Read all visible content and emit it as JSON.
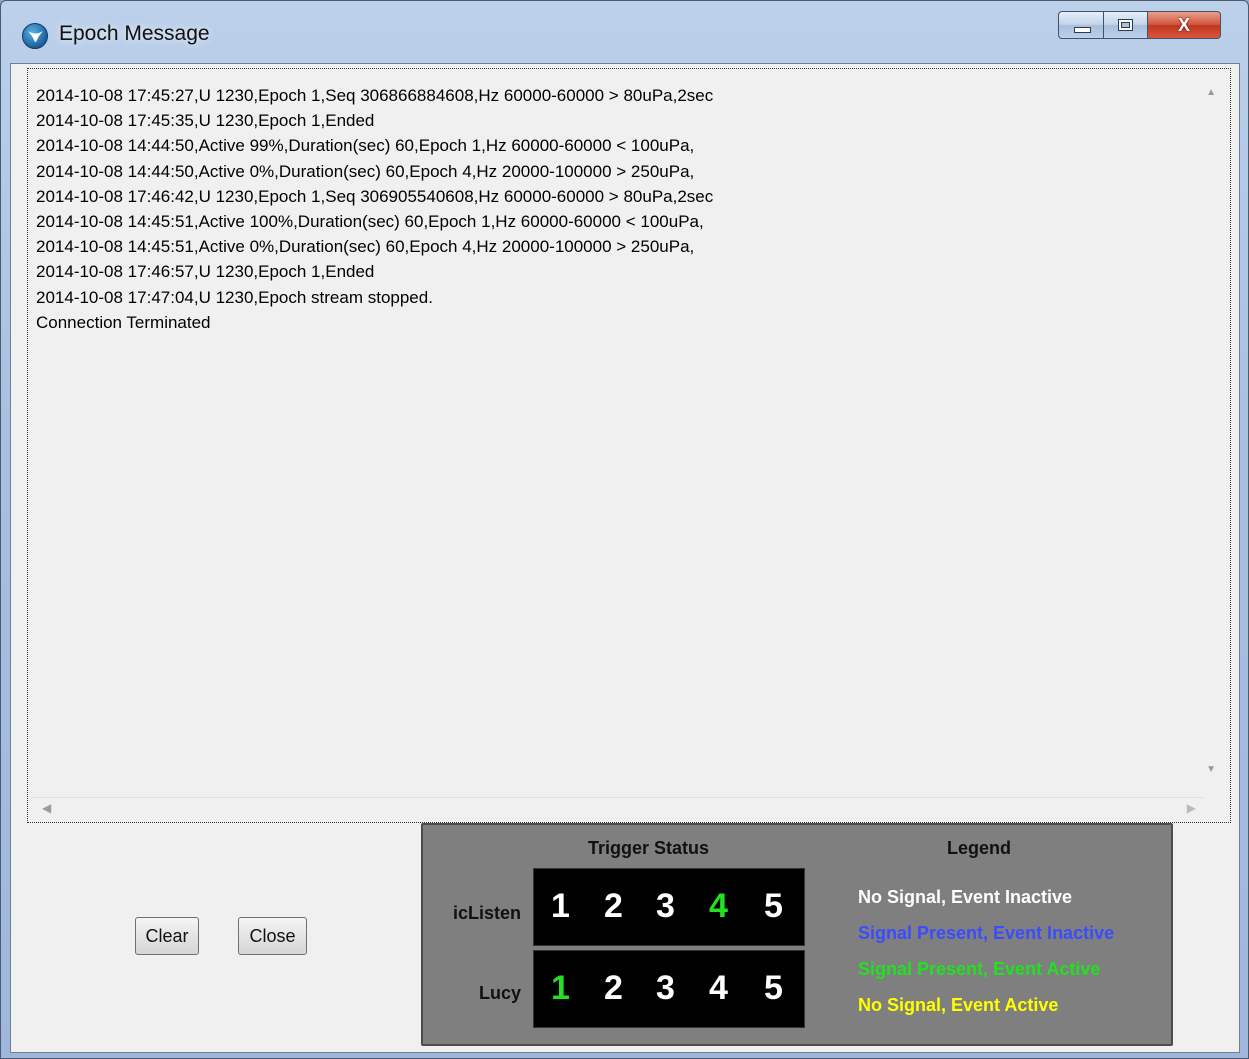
{
  "window": {
    "title": "Epoch Message",
    "close_label": "X"
  },
  "messages": [
    "2014-10-08 17:45:27,U 1230,Epoch 1,Seq 306866884608,Hz 60000-60000 > 80uPa,2sec",
    "2014-10-08 17:45:35,U 1230,Epoch 1,Ended",
    "2014-10-08 14:44:50,Active 99%,Duration(sec) 60,Epoch 1,Hz 60000-60000 < 100uPa,",
    "2014-10-08 14:44:50,Active 0%,Duration(sec) 60,Epoch 4,Hz 20000-100000 > 250uPa,",
    "2014-10-08 17:46:42,U 1230,Epoch 1,Seq 306905540608,Hz 60000-60000 > 80uPa,2sec",
    "2014-10-08 14:45:51,Active 100%,Duration(sec) 60,Epoch 1,Hz 60000-60000 < 100uPa,",
    "2014-10-08 14:45:51,Active 0%,Duration(sec) 60,Epoch 4,Hz 20000-100000 > 250uPa,",
    "2014-10-08 17:46:57,U 1230,Epoch 1,Ended",
    "2014-10-08 17:47:04,U 1230,Epoch stream stopped.",
    "Connection Terminated"
  ],
  "buttons": {
    "clear": "Clear",
    "close": "Close"
  },
  "trigger_status": {
    "heading": "Trigger Status",
    "rows": [
      {
        "label": "icListen",
        "digits": [
          {
            "text": "1",
            "state": "no-signal-inactive"
          },
          {
            "text": "2",
            "state": "no-signal-inactive"
          },
          {
            "text": "3",
            "state": "no-signal-inactive"
          },
          {
            "text": "4",
            "state": "signal-active"
          },
          {
            "text": "5",
            "state": "no-signal-inactive"
          }
        ]
      },
      {
        "label": "Lucy",
        "digits": [
          {
            "text": "1",
            "state": "signal-active"
          },
          {
            "text": "2",
            "state": "no-signal-inactive"
          },
          {
            "text": "3",
            "state": "no-signal-inactive"
          },
          {
            "text": "4",
            "state": "no-signal-inactive"
          },
          {
            "text": "5",
            "state": "no-signal-inactive"
          }
        ]
      }
    ]
  },
  "legend": {
    "heading": "Legend",
    "items": [
      {
        "text": "No Signal, Event Inactive",
        "color": "#ffffff"
      },
      {
        "text": "Signal Present, Event Inactive",
        "color": "#3a4cff"
      },
      {
        "text": "Signal Present, Event Active",
        "color": "#22e022"
      },
      {
        "text": "No Signal, Event Active",
        "color": "#ffff00"
      }
    ]
  },
  "colors": {
    "no-signal-inactive": "#ffffff",
    "signal-inactive": "#3a4cff",
    "signal-active": "#22e022",
    "no-signal-active": "#ffff00"
  }
}
